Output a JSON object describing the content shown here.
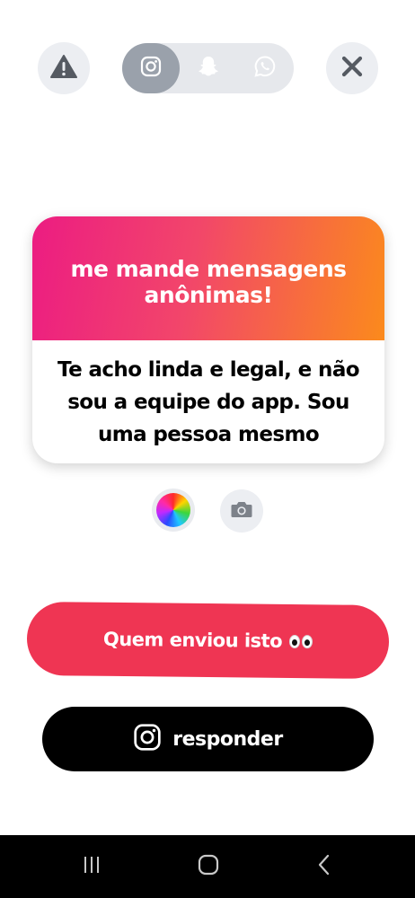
{
  "header": {
    "report_icon": "warning-icon",
    "close_icon": "close-icon",
    "platforms": [
      {
        "name": "instagram",
        "icon": "instagram-icon",
        "active": true
      },
      {
        "name": "snapchat",
        "icon": "snapchat-icon",
        "active": false
      },
      {
        "name": "whatsapp",
        "icon": "whatsapp-icon",
        "active": false
      }
    ]
  },
  "card": {
    "title": "me mande mensagens anônimas!",
    "message": "Te acho linda e legal, e não sou a equipe do app. Sou uma pessoa mesmo"
  },
  "tools": {
    "color_icon": "color-wheel-icon",
    "camera_icon": "camera-icon"
  },
  "actions": {
    "who_sent_label": "Quem enviou isto",
    "who_sent_emoji": "eyes-emoji",
    "reply_label": "responder",
    "reply_icon": "instagram-icon"
  },
  "system_nav": {
    "recent_icon": "recent-apps-icon",
    "home_icon": "home-icon",
    "back_icon": "back-icon"
  },
  "colors": {
    "gradient_start": "#ec1c82",
    "gradient_end": "#fb8a1c",
    "who_button": "#ef3553",
    "reply_button": "#000000"
  }
}
